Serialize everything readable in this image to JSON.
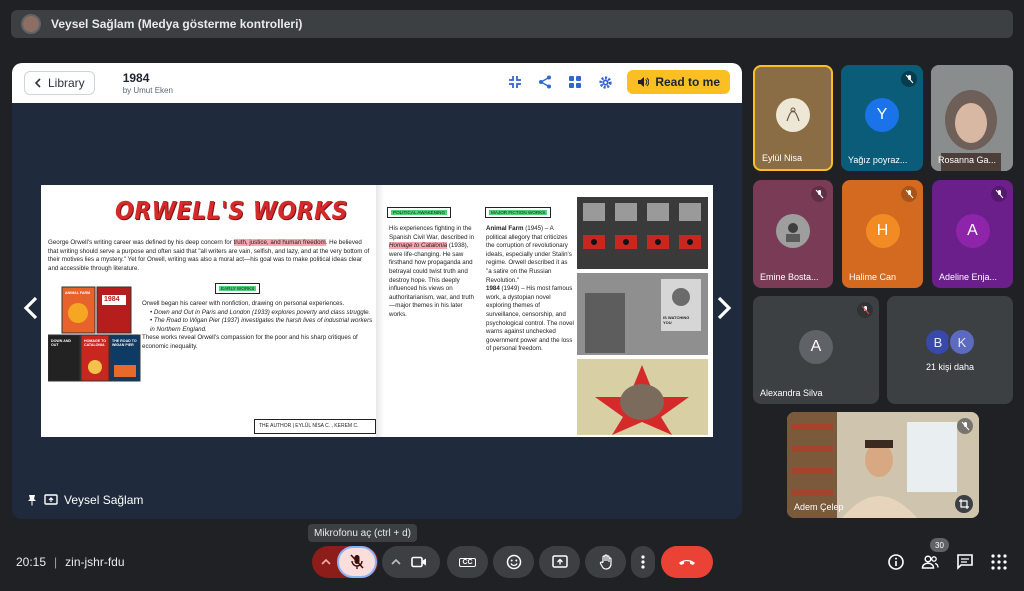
{
  "topbar": {
    "title": "Veysel Sağlam (Medya gösterme kontrolleri)"
  },
  "reader": {
    "library_label": "Library",
    "book_title": "1984",
    "book_author": "by Umut Eken",
    "read_button": "Read to me"
  },
  "book": {
    "heading": "ORWELL'S WORKS",
    "intro_pre": "George Orwell's writing career was defined by his deep concern for ",
    "intro_highlight": "truth, justice, and human freedom",
    "intro_post": ". He believed that writing should serve a purpose and often said that \"all writers are vain, selfish, and lazy, and at the very bottom of their motives lies a mystery.\" Yet for Orwell, writing was also a moral act—his goal was to make political ideas clear and accessible through literature.",
    "tag_early": "EARLY WORKS",
    "early_text": "Orwell began his career with nonfiction, drawing on personal experiences.",
    "early_item_1": "Down and Out in Paris and London (1933) explores poverty and class struggle.",
    "early_item_2": "The Road to Wigan Pier (1937) investigates the harsh lives of industrial workers in Northern England.",
    "early_close": "These works reveal Orwell's compassion for the poor and his sharp critiques of economic inequality.",
    "cover_1984": "1984",
    "cover_animal": "ANIMAL FARM",
    "cover_down": "DOWN AND OUT",
    "cover_homage": "HOMAGE TO CATALONIA",
    "cover_wigan": "THE ROAD TO WIGAN PIER",
    "credit": "THE AUTHOR | EYLÜL NİSA C. , KEREM C.",
    "tag_political": "POLITICAL AWAKENING",
    "political_pre": "His experiences fighting in the Spanish Civil War, described in ",
    "political_highlight": "Homage to Catalonia",
    "political_post": " (1938), were life-changing. He saw firsthand how propaganda and betrayal could twist truth and destroy hope. This deeply influenced his views on authoritarianism, war, and truth—major themes in his later works.",
    "tag_major": "MAJOR FICTION WORKS",
    "af_title": "Animal Farm",
    "af_text": " (1945) – A political allegory that criticizes the corruption of revolutionary ideals, especially under Stalin's regime. Orwell described it as \"a satire on the Russian Revolution.\"",
    "n_title": "1984",
    "n_text": " (1949) – His most famous work, a dystopian novel exploring themes of surveillance, censorship, and psychological control. The novel warns against unchecked government power and the loss of personal freedom.",
    "poster_text": "IS WATCHING YOU"
  },
  "presenter_label": "Veysel Sağlam",
  "participants": [
    {
      "name": "Eylül Nisa",
      "initial": ""
    },
    {
      "name": "Yağız poyraz...",
      "initial": "Y"
    },
    {
      "name": "Rosanna Ga...",
      "initial": ""
    },
    {
      "name": "Emine Bosta...",
      "initial": ""
    },
    {
      "name": "Halime Can",
      "initial": "H"
    },
    {
      "name": "Adeline Enja...",
      "initial": "A"
    },
    {
      "name": "Alexandra Silva",
      "initial": "A"
    },
    {
      "name": "Adem Çelep",
      "initial": ""
    }
  ],
  "more": {
    "label": "21 kişi daha",
    "initial_1": "B",
    "initial_2": "K"
  },
  "controls": {
    "tooltip": "Mikrofonu aç (ctrl + d)",
    "time": "20:15",
    "meeting_code": "zin-jshr-fdu",
    "participant_count": "30",
    "cc_label": "CC"
  },
  "colors": {
    "accent": "#fbbf24",
    "danger": "#ea4335",
    "brand_blue": "#3366cc"
  }
}
